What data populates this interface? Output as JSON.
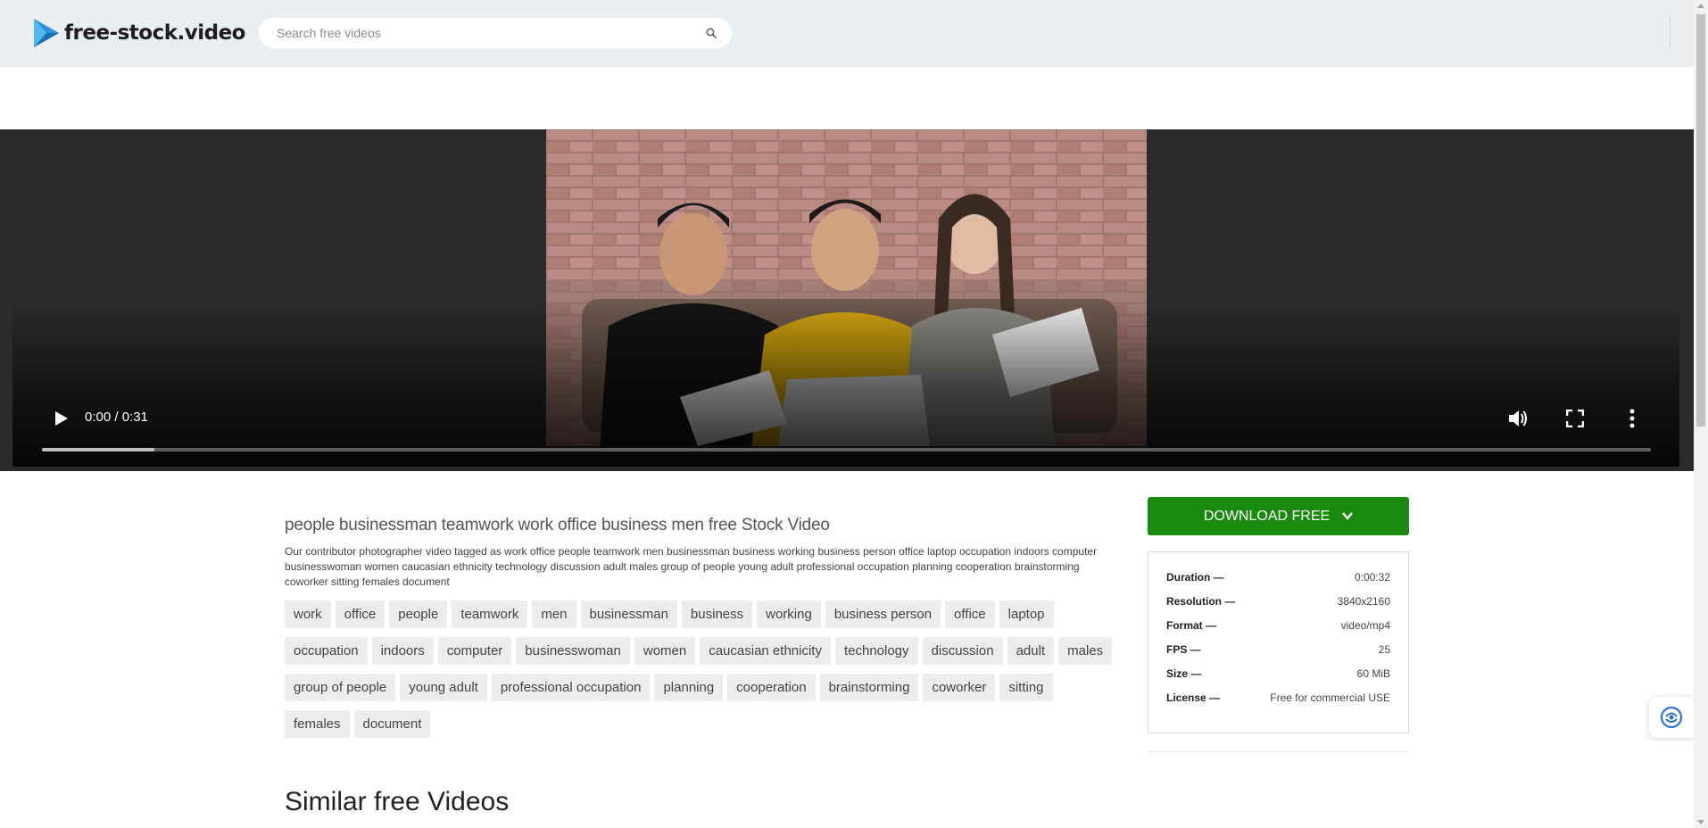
{
  "header": {
    "logo_text": "free-stock.video",
    "search_placeholder": "Search free videos",
    "icons": {
      "search": "search-icon",
      "logo": "play-triangle-logo-icon"
    }
  },
  "player": {
    "time_display": "0:00 / 0:31",
    "progress_fraction": 0,
    "buffered_fraction": 0.07,
    "icons": {
      "play": "play-icon",
      "volume": "volume-icon",
      "fullscreen": "fullscreen-icon",
      "more": "more-vertical-icon"
    }
  },
  "video": {
    "title": "people businessman teamwork work office business men free Stock Video",
    "description": "Our contributor photographer video tagged as work office people teamwork men businessman business working business person office laptop occupation indoors computer businesswoman women caucasian ethnicity technology discussion adult males group of people young adult professional occupation planning cooperation brainstorming coworker sitting females document",
    "tags": [
      "work",
      "office",
      "people",
      "teamwork",
      "men",
      "businessman",
      "business",
      "working",
      "business person",
      "office",
      "laptop",
      "occupation",
      "indoors",
      "computer",
      "businesswoman",
      "women",
      "caucasian ethnicity",
      "technology",
      "discussion",
      "adult",
      "males",
      "group of people",
      "young adult",
      "professional occupation",
      "planning",
      "cooperation",
      "brainstorming",
      "coworker",
      "sitting",
      "females",
      "document"
    ]
  },
  "download": {
    "label": "DOWNLOAD FREE",
    "icon": "chevron-down-icon",
    "color": "#1a8a0f"
  },
  "meta": [
    {
      "key": "Duration —",
      "value": "0:00:32"
    },
    {
      "key": "Resolution —",
      "value": "3840x2160"
    },
    {
      "key": "Format —",
      "value": "video/mp4"
    },
    {
      "key": "FPS —",
      "value": "25"
    },
    {
      "key": "Size —",
      "value": "60 MiB"
    },
    {
      "key": "License —",
      "value": "Free for commercial USE"
    }
  ],
  "similar_heading": "Similar free Videos",
  "widget": {
    "icon": "translate-assistant-icon"
  }
}
